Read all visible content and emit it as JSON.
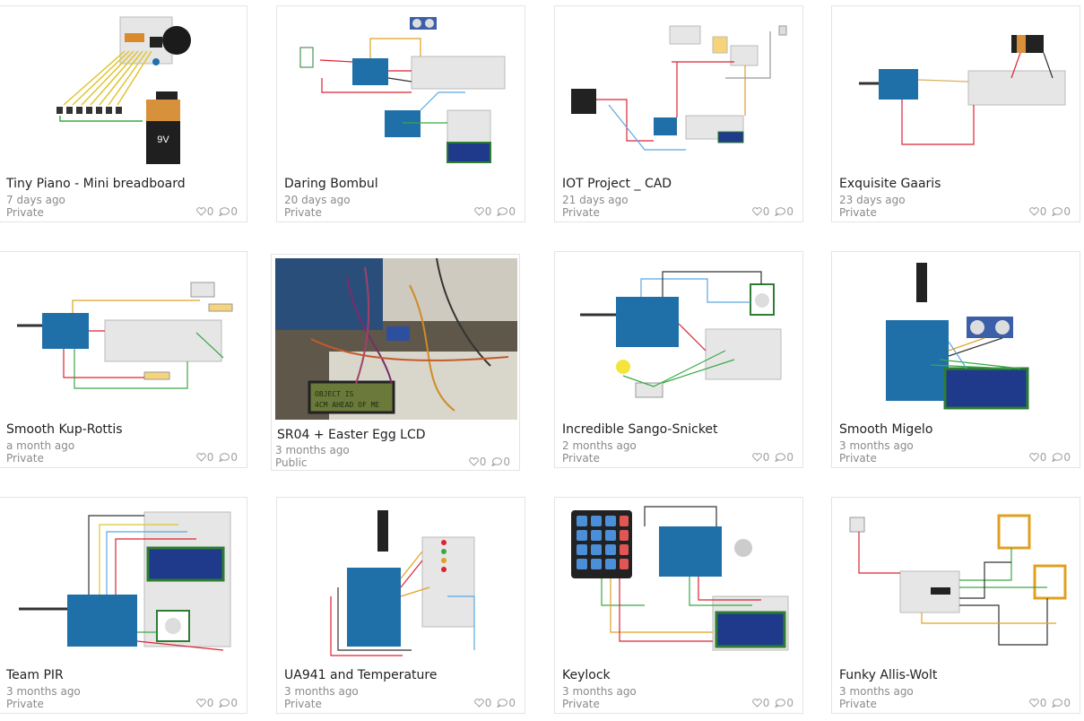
{
  "projects": [
    {
      "title": "Tiny Piano - Mini breadboard",
      "age": "7 days ago",
      "visibility": "Private",
      "likes": "0",
      "comments": "0"
    },
    {
      "title": "Daring Bombul",
      "age": "20 days ago",
      "visibility": "Private",
      "likes": "0",
      "comments": "0"
    },
    {
      "title": "IOT Project _ CAD",
      "age": "21 days ago",
      "visibility": "Private",
      "likes": "0",
      "comments": "0"
    },
    {
      "title": "Exquisite Gaaris",
      "age": "23 days ago",
      "visibility": "Private",
      "likes": "0",
      "comments": "0"
    },
    {
      "title": "Smooth Kup-Rottis",
      "age": "a month ago",
      "visibility": "Private",
      "likes": "0",
      "comments": "0"
    },
    {
      "title": "SR04 + Easter Egg LCD",
      "age": "3 months ago",
      "visibility": "Public",
      "likes": "0",
      "comments": "0"
    },
    {
      "title": "Incredible Sango-Snicket",
      "age": "2 months ago",
      "visibility": "Private",
      "likes": "0",
      "comments": "0"
    },
    {
      "title": "Smooth Migelo",
      "age": "3 months ago",
      "visibility": "Private",
      "likes": "0",
      "comments": "0"
    },
    {
      "title": "Team PIR",
      "age": "3 months ago",
      "visibility": "Private",
      "likes": "0",
      "comments": "0"
    },
    {
      "title": "UA941 and Temperature",
      "age": "3 months ago",
      "visibility": "Private",
      "likes": "0",
      "comments": "0"
    },
    {
      "title": "Keylock",
      "age": "3 months ago",
      "visibility": "Private",
      "likes": "0",
      "comments": "0"
    },
    {
      "title": "Funky Allis-Wolt",
      "age": "3 months ago",
      "visibility": "Private",
      "likes": "0",
      "comments": "0"
    }
  ],
  "thumb_text": {
    "battery": "9V",
    "lcd_line1": "OBJECT IS",
    "lcd_line2": "4CM AHEAD OF ME"
  },
  "colors": {
    "arduino": "#1f6fa8",
    "breadboard": "#e6e6e6",
    "lcd": "#1f3a8a",
    "lcd_frame": "#2e7d32"
  }
}
